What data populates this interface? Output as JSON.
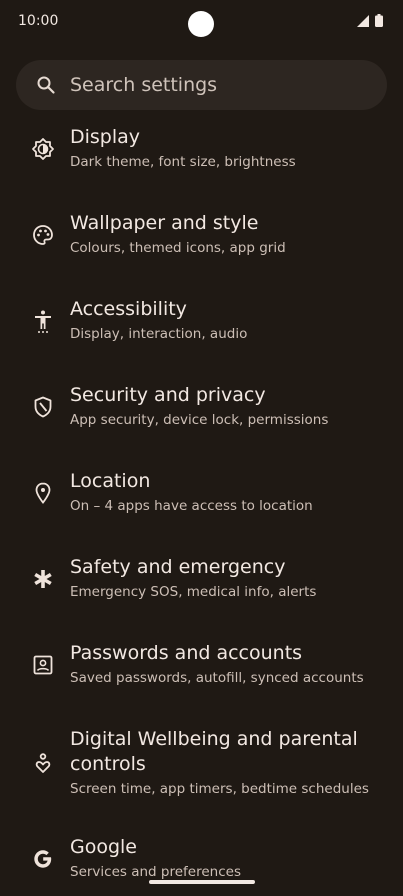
{
  "status_bar": {
    "time": "10:00"
  },
  "search": {
    "label": "Search settings"
  },
  "items": [
    {
      "icon": "brightness-icon",
      "title": "Display",
      "subtitle": "Dark theme, font size, brightness"
    },
    {
      "icon": "palette-icon",
      "title": "Wallpaper and style",
      "subtitle": "Colours, themed icons, app grid"
    },
    {
      "icon": "accessibility-icon",
      "title": "Accessibility",
      "subtitle": "Display, interaction, audio"
    },
    {
      "icon": "shield-icon",
      "title": "Security and privacy",
      "subtitle": "App security, device lock, permissions"
    },
    {
      "icon": "location-pin-icon",
      "title": "Location",
      "subtitle": "On – 4 apps have access to location"
    },
    {
      "icon": "emergency-asterisk-icon",
      "title": "Safety and emergency",
      "subtitle": "Emergency SOS, medical info, alerts"
    },
    {
      "icon": "account-box-icon",
      "title": "Passwords and accounts",
      "subtitle": "Saved passwords, autofill, synced accounts"
    },
    {
      "icon": "wellbeing-icon",
      "title": "Digital Wellbeing and parental controls",
      "subtitle": "Screen time, app timers, bedtime schedules"
    },
    {
      "icon": "google-icon",
      "title": "Google",
      "subtitle": "Services and preferences"
    }
  ]
}
